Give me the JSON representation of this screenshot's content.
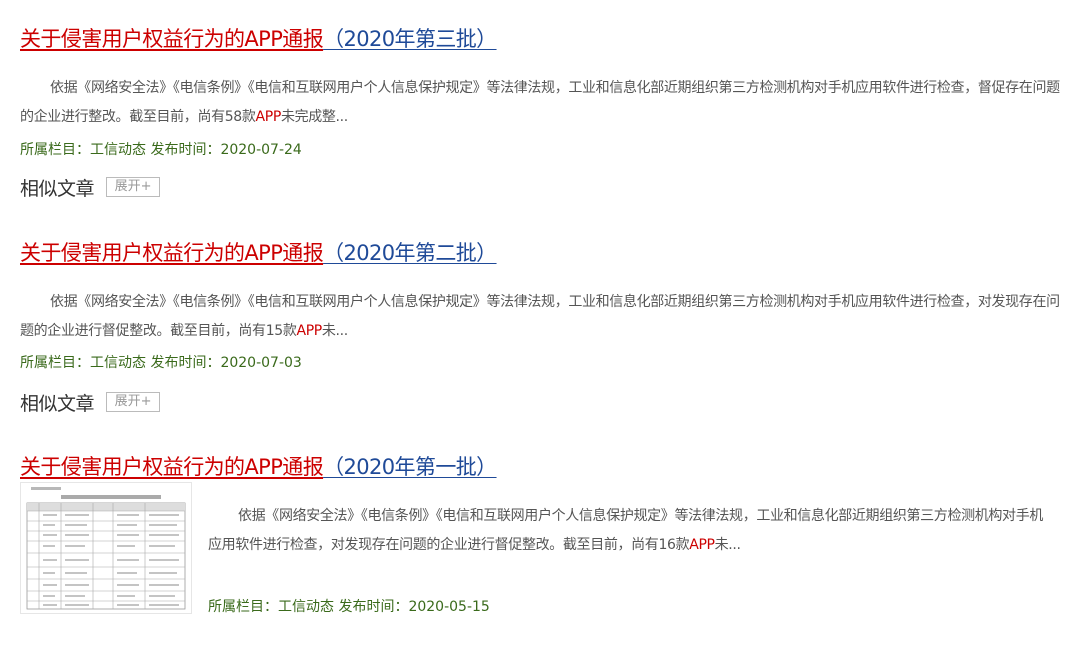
{
  "results": [
    {
      "title_keyword": "关于侵害用户权益行为的APP通报",
      "title_rest": "（2020年第三批）",
      "desc_before": "依据《网络安全法》《电信条例》《电信和互联网用户个人信息保护规定》等法律法规，工业和信息化部近期组织第三方检测机构对手机应用软件进行检查，督促存在问题的企业进行整改。截至目前，尚有58款",
      "desc_highlight": "APP",
      "desc_after": "未完成整...",
      "meta": "所属栏目：工信动态 发布时间：2020-07-24",
      "similar_label": "相似文章",
      "expand_label": "展开+"
    },
    {
      "title_keyword": "关于侵害用户权益行为的APP通报",
      "title_rest": "（2020年第二批）",
      "desc_before": "依据《网络安全法》《电信条例》《电信和互联网用户个人信息保护规定》等法律法规，工业和信息化部近期组织第三方检测机构对手机应用软件进行检查，对发现存在问题的企业进行督促整改。截至目前，尚有15款",
      "desc_highlight": "APP",
      "desc_after": "未...",
      "meta": "所属栏目：工信动态 发布时间：2020-07-03",
      "similar_label": "相似文章",
      "expand_label": "展开+"
    },
    {
      "title_keyword": "关于侵害用户权益行为的APP通报",
      "title_rest": "（2020年第一批）",
      "desc_before": "依据《网络安全法》《电信条例》《电信和互联网用户个人信息保护规定》等法律法规，工业和信息化部近期组织第三方检测机构对手机应用软件进行检查，对发现存在问题的企业进行督促整改。截至目前，尚有16款",
      "desc_highlight": "APP",
      "desc_after": "未...",
      "meta": "所属栏目：工信动态 发布时间：2020-05-15"
    }
  ],
  "colors": {
    "keyword": "#cc0000",
    "title_link": "#1f4a98",
    "meta": "#3a6a1b",
    "body_text": "#555555"
  }
}
